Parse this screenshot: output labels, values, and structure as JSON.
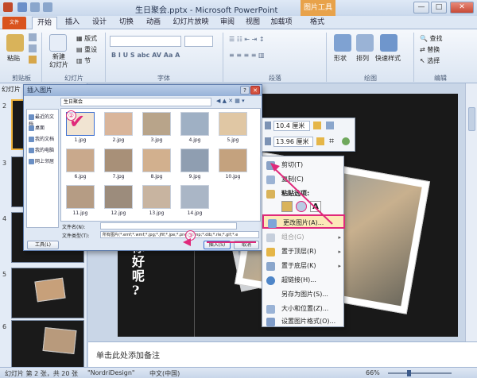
{
  "window": {
    "title": "生日聚会.pptx - Microsoft PowerPoint",
    "picture_tools_label": "图片工具",
    "minimize": "—",
    "maximize": "□",
    "close": "✕"
  },
  "tabs": [
    {
      "label": "文件"
    },
    {
      "label": "开始"
    },
    {
      "label": "插入"
    },
    {
      "label": "设计"
    },
    {
      "label": "切换"
    },
    {
      "label": "动画"
    },
    {
      "label": "幻灯片放映"
    },
    {
      "label": "审阅"
    },
    {
      "label": "视图"
    },
    {
      "label": "加载项"
    },
    {
      "label": "格式"
    }
  ],
  "ribbon": {
    "paste": "粘贴",
    "clipboard_group": "剪贴板",
    "new_slide": "新建\n幻灯片",
    "layout": "版式",
    "reset": "重设",
    "section": "节",
    "slides_group": "幻灯片",
    "font_group": "字体",
    "paragraph_group": "段落",
    "shape": "形状",
    "arrange": "排列",
    "quick_styles": "快速样式",
    "drawing_group": "绘图",
    "find": "查找",
    "replace": "替换",
    "select": "选择",
    "editing_group": "编辑"
  },
  "left_panel": {
    "header_tab": "幻灯片",
    "slide_numbers": [
      "2",
      "3",
      "4",
      "5",
      "6"
    ]
  },
  "slide": {
    "text": "你\n好\n呢\n?"
  },
  "dialog": {
    "title": "插入图片",
    "path": "生日聚会",
    "places": [
      "最近的文档",
      "桌面",
      "我的文档",
      "我的电脑",
      "网上邻居"
    ],
    "files": [
      "1.jpg",
      "2.jpg",
      "3.jpg",
      "4.jpg",
      "5.jpg",
      "6.jpg",
      "7.jpg",
      "8.jpg",
      "9.jpg",
      "10.jpg",
      "11.jpg",
      "12.jpg",
      "13.jpg",
      "14.jpg"
    ],
    "filename_label": "文件名(N):",
    "filetype_label": "文件类型(T):",
    "filetype_value": "所有图片(*.emf;*.wmf;*.jpg;*.jfif;*.jpe;*.png;*.bmp;*.dib;*.rle;*.gif;*.e",
    "tools_button": "工具(L)",
    "insert_button": "插入(S)",
    "cancel_button": "取消"
  },
  "mini_toolbar": {
    "height": "10.4 厘米",
    "width": "13.96 厘米"
  },
  "context_menu": {
    "items": [
      {
        "label": "剪切(T)",
        "enabled": true
      },
      {
        "label": "复制(C)",
        "enabled": true
      },
      {
        "label": "粘贴选项:",
        "enabled": true
      },
      {
        "label": "更改图片(A)...",
        "enabled": true,
        "highlight": true
      },
      {
        "label": "组合(G)",
        "enabled": false
      },
      {
        "label": "置于顶层(R)",
        "enabled": true
      },
      {
        "label": "置于底层(K)",
        "enabled": true
      },
      {
        "label": "超链接(H)...",
        "enabled": true
      },
      {
        "label": "另存为图片(S)...",
        "enabled": true
      },
      {
        "label": "大小和位置(Z)...",
        "enabled": true
      },
      {
        "label": "设置图片格式(O)...",
        "enabled": true
      }
    ]
  },
  "annotations": {
    "step2": "②",
    "step3": "③"
  },
  "notes": {
    "placeholder": "单击此处添加备注"
  },
  "status": {
    "slide_info": "幻灯片 第 2 张，共 20 张",
    "theme": "\"NordriDesign\"",
    "language": "中文(中国)",
    "zoom": "66%"
  }
}
